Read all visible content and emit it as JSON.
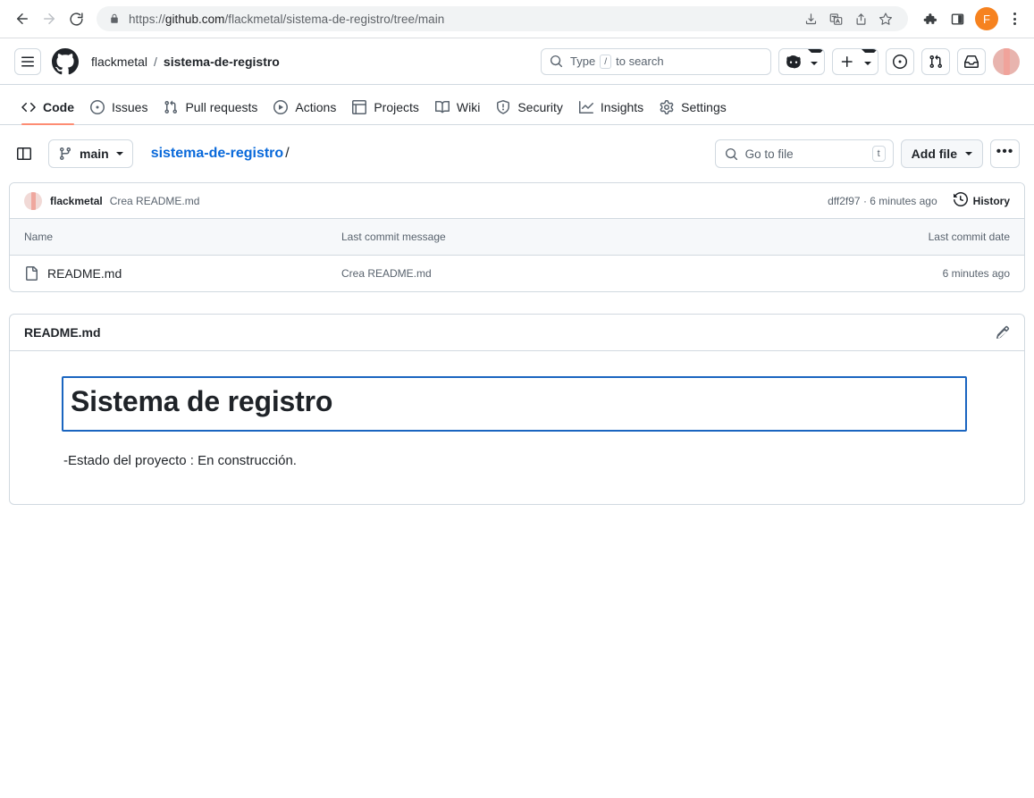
{
  "browser": {
    "back_label": "Back",
    "forward_label": "Forward",
    "reload_label": "Reload",
    "url_prefix": "https://",
    "url_domain": "github.com",
    "url_path": "/flackmetal/sistema-de-registro/tree/main",
    "omnibox_icons": [
      "download-icon",
      "translate-icon",
      "share-icon",
      "bookmark-star-icon"
    ],
    "toolbar_icons": [
      "extensions-puzzle-icon",
      "side-panel-icon"
    ],
    "profile_initial": "F",
    "profile_color": "#f6821f",
    "menu_label": "Chrome menu"
  },
  "gh_header": {
    "menu_label": "Open global navigation menu",
    "logo_label": "Homepage",
    "owner": "flackmetal",
    "separator": "/",
    "repo": "sistema-de-registro",
    "search": {
      "placeholder": "Type",
      "key_hint": "/",
      "placeholder_tail": "to search"
    },
    "copilot_label": "Copilot",
    "create_new_label": "Create new...",
    "issues_label": "Your issues",
    "pull_requests_label": "Your pull requests",
    "inbox_label": "Notifications",
    "avatar_label": "Open user account menu"
  },
  "repo_nav": {
    "active": "Code",
    "tabs": [
      {
        "label": "Code",
        "icon": "code-icon"
      },
      {
        "label": "Issues",
        "icon": "issue-opened-icon"
      },
      {
        "label": "Pull requests",
        "icon": "git-pull-request-icon"
      },
      {
        "label": "Actions",
        "icon": "play-icon"
      },
      {
        "label": "Projects",
        "icon": "table-icon"
      },
      {
        "label": "Wiki",
        "icon": "book-icon"
      },
      {
        "label": "Security",
        "icon": "shield-icon"
      },
      {
        "label": "Insights",
        "icon": "graph-icon"
      },
      {
        "label": "Settings",
        "icon": "gear-icon"
      }
    ],
    "active_indicator_color": "#fd8c73"
  },
  "toolbar": {
    "sidebar_toggle_label": "Toggle file tree",
    "branch": "main",
    "path_repo": "sistema-de-registro",
    "path_slash": "/",
    "go_to_file_placeholder": "Go to file",
    "go_to_file_key": "t",
    "add_file_label": "Add file",
    "more_options_label": "•••"
  },
  "commit_bar": {
    "author": "flackmetal",
    "message": "Crea README.md",
    "sha_and_time": "dff2f97 · 6 minutes ago",
    "history_label": "History"
  },
  "file_table": {
    "columns": [
      "Name",
      "Last commit message",
      "Last commit date"
    ],
    "rows": [
      {
        "name": "README.md",
        "icon": "file-icon",
        "commit_message": "Crea README.md",
        "commit_date": "6 minutes ago"
      }
    ]
  },
  "readme": {
    "title": "README.md",
    "edit_label": "Edit file",
    "heading": "Sistema de registro",
    "paragraph": "-Estado del proyecto : En construcción.",
    "highlight_color": "#1a65c0"
  }
}
